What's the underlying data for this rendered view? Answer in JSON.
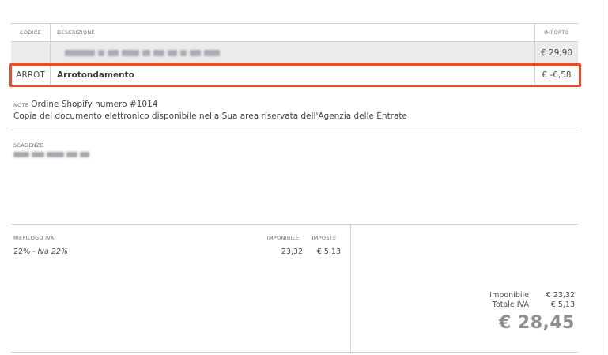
{
  "table": {
    "headers": {
      "code": "CODICE",
      "description": "DESCRIZIONE",
      "amount": "IMPORTO"
    },
    "rows": [
      {
        "code": "",
        "description": "",
        "amount": "€ 29,90"
      },
      {
        "code": "ARROT",
        "description": "Arrotondamento",
        "amount": "€ -6,58"
      }
    ]
  },
  "notes": {
    "label": "NOTE",
    "line1": "Ordine Shopify numero #1014",
    "line2": "Copia del documento elettronico disponibile nella Sua area riservata dell'Agenzia delle Entrate"
  },
  "scadenze": {
    "label": "SCADENZE"
  },
  "vat_summary": {
    "label": "RIEPILOGO IVA",
    "taxable_header": "IMPONIBILE",
    "tax_header": "IMPOSTE",
    "rows": [
      {
        "rate": "22% - ",
        "rate_desc": "Iva 22%",
        "taxable": "23,32",
        "tax": "€ 5,13"
      }
    ]
  },
  "totals": {
    "taxable_label": "Imponibile",
    "taxable_value": "€ 23,32",
    "vat_label": "Totale IVA",
    "vat_value": "€ 5,13",
    "grand_total": "€ 28,45"
  },
  "colors": {
    "highlight": "#ea4d2c",
    "row_shade": "#ebebeb",
    "grand_total": "#8e8e8e"
  }
}
